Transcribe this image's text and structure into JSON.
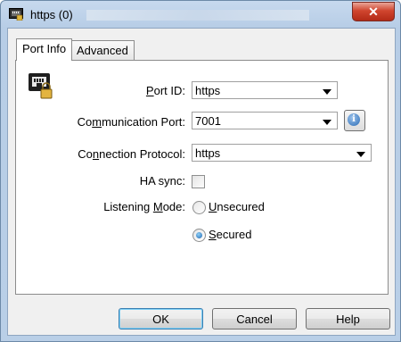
{
  "window": {
    "title": "https (0)"
  },
  "tabs": [
    {
      "label": "Port Info"
    },
    {
      "label": "Advanced"
    }
  ],
  "form": {
    "port_id": {
      "label_pre": "",
      "label_u": "P",
      "label_post": "ort ID:",
      "value": "https"
    },
    "comm_port": {
      "label_pre": "Co",
      "label_u": "m",
      "label_post": "munication Port:",
      "value": "7001"
    },
    "protocol": {
      "label_pre": "Co",
      "label_u": "n",
      "label_post": "nection Protocol:",
      "value": "https"
    },
    "ha_sync": {
      "label": "HA sync:",
      "checked": false
    },
    "listening_mode": {
      "label_pre": "Listening ",
      "label_u": "M",
      "label_post": "ode:",
      "options": [
        {
          "u": "U",
          "rest": "nsecured",
          "checked": false
        },
        {
          "u": "S",
          "rest": "ecured",
          "checked": true
        }
      ]
    }
  },
  "buttons": {
    "ok": "OK",
    "cancel": "Cancel",
    "help": "Help"
  },
  "icons": {
    "title": "port-icon",
    "close": "close-icon",
    "info": "info-icon",
    "port_lock": "port-lock-icon"
  }
}
